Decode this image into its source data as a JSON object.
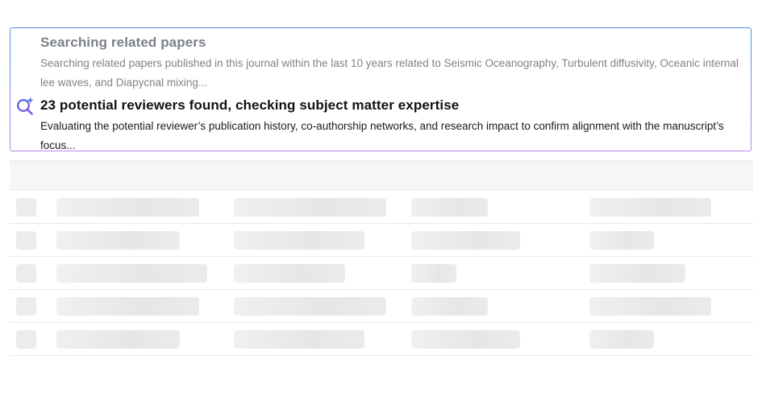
{
  "progress": {
    "previous_step": {
      "title": "Searching related papers",
      "description": "Searching related papers published in this journal within the last 10 years related to Seismic Oceanography, Turbulent diffusivity, Oceanic internal lee waves, and Diapycnal mixing..."
    },
    "current_step": {
      "icon": "sparkle-search-icon",
      "title": "23 potential reviewers found, checking subject matter expertise",
      "description": "Evaluating the potential reviewer’s publication history, co-authorship networks, and research impact to confirm alignment with the manuscript’s focus..."
    }
  },
  "colors": {
    "card_border_top": "#4f8fe0",
    "card_border_bottom": "#b88ae6",
    "icon_accent": "#5b6fe0",
    "muted_text": "#7a8087",
    "skeleton": "#e6e6e6",
    "table_header": "#f5f6f7"
  },
  "table": {
    "state": "loading",
    "row_count": 5
  }
}
